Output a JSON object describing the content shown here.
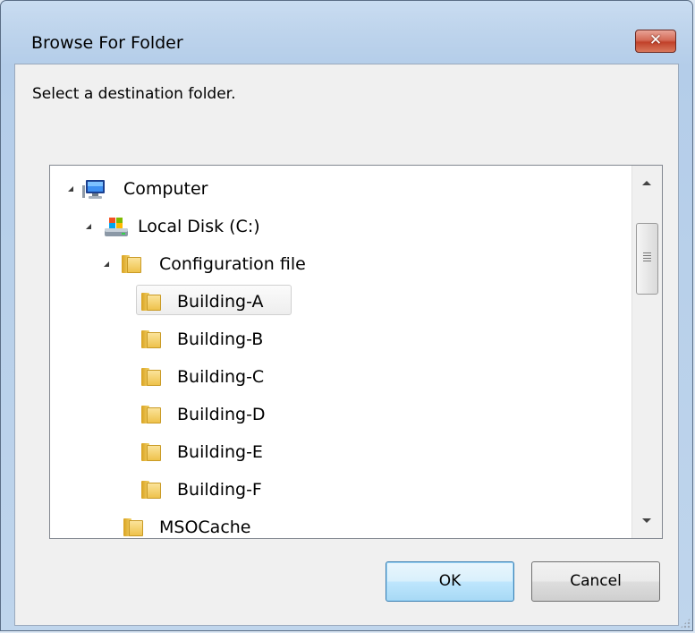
{
  "window": {
    "title": "Browse For Folder",
    "close_label": "✕"
  },
  "dialog": {
    "prompt": "Select a destination folder."
  },
  "tree": {
    "items": [
      {
        "label": "Computer",
        "icon": "computer-icon",
        "expanded": true,
        "level": 0
      },
      {
        "label": "Local Disk (C:)",
        "icon": "local-disk-icon",
        "expanded": true,
        "level": 1
      },
      {
        "label": "Configuration file",
        "icon": "folder-icon",
        "expanded": true,
        "level": 2
      },
      {
        "label": "Building-A",
        "icon": "folder-icon",
        "selected": true,
        "level": 3
      },
      {
        "label": "Building-B",
        "icon": "folder-icon",
        "level": 3
      },
      {
        "label": "Building-C",
        "icon": "folder-icon",
        "level": 3
      },
      {
        "label": "Building-D",
        "icon": "folder-icon",
        "level": 3
      },
      {
        "label": "Building-E",
        "icon": "folder-icon",
        "level": 3
      },
      {
        "label": "Building-F",
        "icon": "folder-icon",
        "level": 3
      },
      {
        "label": "MSOCache",
        "icon": "folder-icon",
        "level": 2
      }
    ]
  },
  "buttons": {
    "ok_label": "OK",
    "cancel_label": "Cancel"
  },
  "colors": {
    "frame": "#bed4ec",
    "close_button": "#c1412a",
    "default_button": "#bee6fd"
  }
}
